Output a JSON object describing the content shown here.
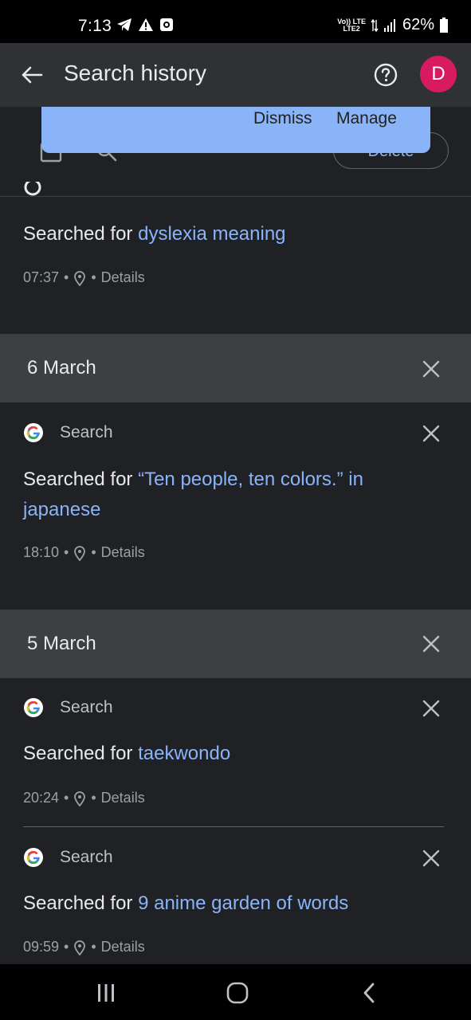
{
  "status": {
    "time": "7:13",
    "volte": "Vo)) LTE",
    "lte2": "LTE2",
    "battery": "62%"
  },
  "header": {
    "title": "Search history",
    "avatar_initial": "D"
  },
  "toolbar": {
    "delete_label": "Delete"
  },
  "snackbar": {
    "dismiss": "Dismiss",
    "manage": "Manage"
  },
  "entries": [
    {
      "prefix": "Searched for ",
      "query": "dyslexia meaning",
      "time": "07:37",
      "details": "Details"
    },
    {
      "source": "Search",
      "prefix": "Searched for ",
      "query": "“Ten people, ten colors.” in japanese",
      "time": "18:10",
      "details": "Details"
    },
    {
      "source": "Search",
      "prefix": "Searched for ",
      "query": "taekwondo",
      "time": "20:24",
      "details": "Details"
    },
    {
      "source": "Search",
      "prefix": "Searched for ",
      "query": "9 anime garden of words",
      "time": "09:59",
      "details": "Details"
    }
  ],
  "dates": [
    {
      "label": "6 March"
    },
    {
      "label": "5 March"
    }
  ],
  "colors": {
    "accent": "#8ab4f8",
    "avatar": "#d81b60",
    "background": "#202124"
  }
}
